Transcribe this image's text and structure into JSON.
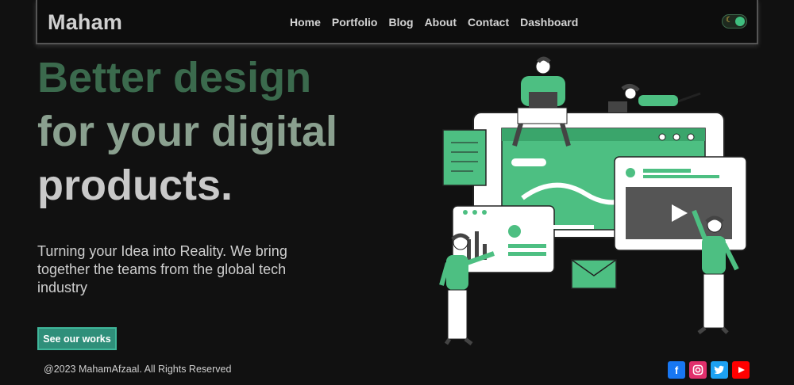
{
  "header": {
    "brand": "Maham",
    "nav": [
      "Home",
      "Portfolio",
      "Blog",
      "About",
      "Contact",
      "Dashboard"
    ],
    "theme_toggle_icon": "moon-icon"
  },
  "hero": {
    "line1": "Better design",
    "line2": "for your digital",
    "line3": "products.",
    "subtitle": "Turning your Idea into Reality. We bring together the teams from the global tech industry",
    "cta_label": "See our works"
  },
  "footer": {
    "copyright": "@2023 MahamAfzaal. All Rights Reserved",
    "socials": [
      "facebook-icon",
      "instagram-icon",
      "twitter-icon",
      "youtube-icon"
    ]
  },
  "colors": {
    "accent": "#4dbf82",
    "headline1": "#3b6a4d",
    "headline2": "#8aa08f",
    "headline3": "#c9c9c9"
  }
}
